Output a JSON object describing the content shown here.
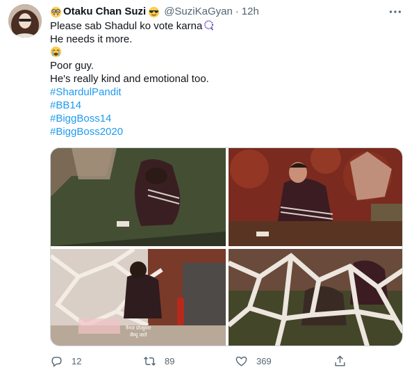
{
  "tweet": {
    "display_name": "Otaku Chan Suzi",
    "handle": "@SuziKaGyan",
    "separator": "·",
    "time": "12h",
    "lines": [
      "Please sab Shadul ko vote karna",
      "He needs it more.",
      "",
      "Poor guy.",
      "He's really kind and emotional too."
    ],
    "hashtags": [
      "#ShardulPandit",
      "#BB14",
      "#BiggBoss14",
      "#BiggBoss2020"
    ],
    "subtitle_lines": [
      "नैनज प्रोत्सुमार",
      "जैम्यू जातें"
    ]
  },
  "actions": {
    "reply_count": "12",
    "retweet_count": "89",
    "like_count": "369"
  },
  "icons": {
    "name_emojis": [
      "nerd-face-icon",
      "sunglasses-face-icon"
    ],
    "line1_emoji": "prayer-beads-icon",
    "line3_emoji": "crying-face-icon",
    "more": "more-icon",
    "reply": "reply-icon",
    "retweet": "retweet-icon",
    "like": "heart-icon",
    "share": "share-icon"
  },
  "colors": {
    "link": "#1d9bf0",
    "secondary": "#536471",
    "text": "#0f1419"
  }
}
